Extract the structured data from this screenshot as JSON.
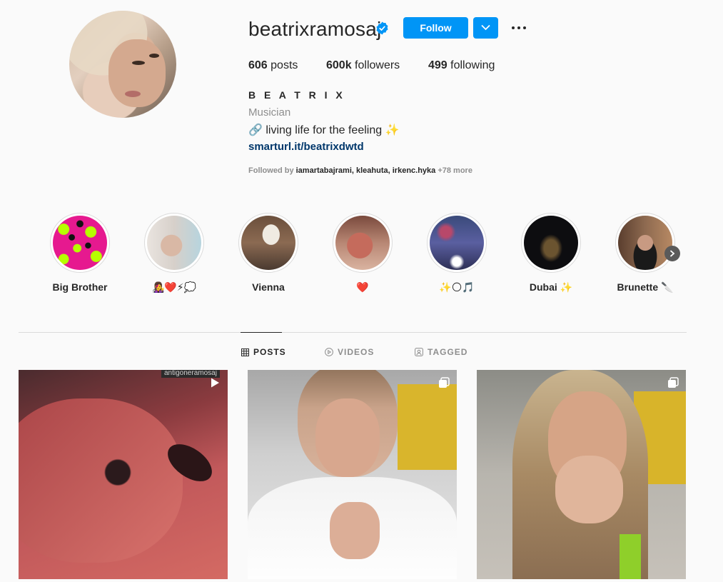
{
  "profile": {
    "username": "beatrixramosaj",
    "verified": true,
    "follow_label": "Follow",
    "posts_count": "606",
    "posts_label": "posts",
    "followers_count": "600k",
    "followers_label": "followers",
    "following_count": "499",
    "following_label": "following",
    "full_name": "B E A T R I X",
    "category": "Musician",
    "bio": "🔗 living life for the feeling ✨",
    "link": "smarturl.it/beatrixdwtd",
    "followed_by_prefix": "Followed by",
    "followed_by_names": "iamartabajrami, kleahuta, irkenc.hyka",
    "followed_by_more": "+78 more"
  },
  "highlights": [
    {
      "label": "Big Brother"
    },
    {
      "label": "👩‍🎤❤️⚡💭"
    },
    {
      "label": "Vienna"
    },
    {
      "label": "❤️"
    },
    {
      "label": "✨🌕🎵"
    },
    {
      "label": "Dubai ✨"
    },
    {
      "label": "Brunette 🔪"
    }
  ],
  "tabs": [
    {
      "label": "POSTS",
      "active": true
    },
    {
      "label": "VIDEOS",
      "active": false
    },
    {
      "label": "TAGGED",
      "active": false
    }
  ],
  "posts": [
    {
      "type": "video-icon",
      "overlay": "antigoneramosaj"
    },
    {
      "type": "carousel-icon"
    },
    {
      "type": "carousel-icon"
    }
  ],
  "colors": {
    "accent": "#0095f6",
    "link": "#00376b",
    "muted": "#8e8e8e"
  }
}
